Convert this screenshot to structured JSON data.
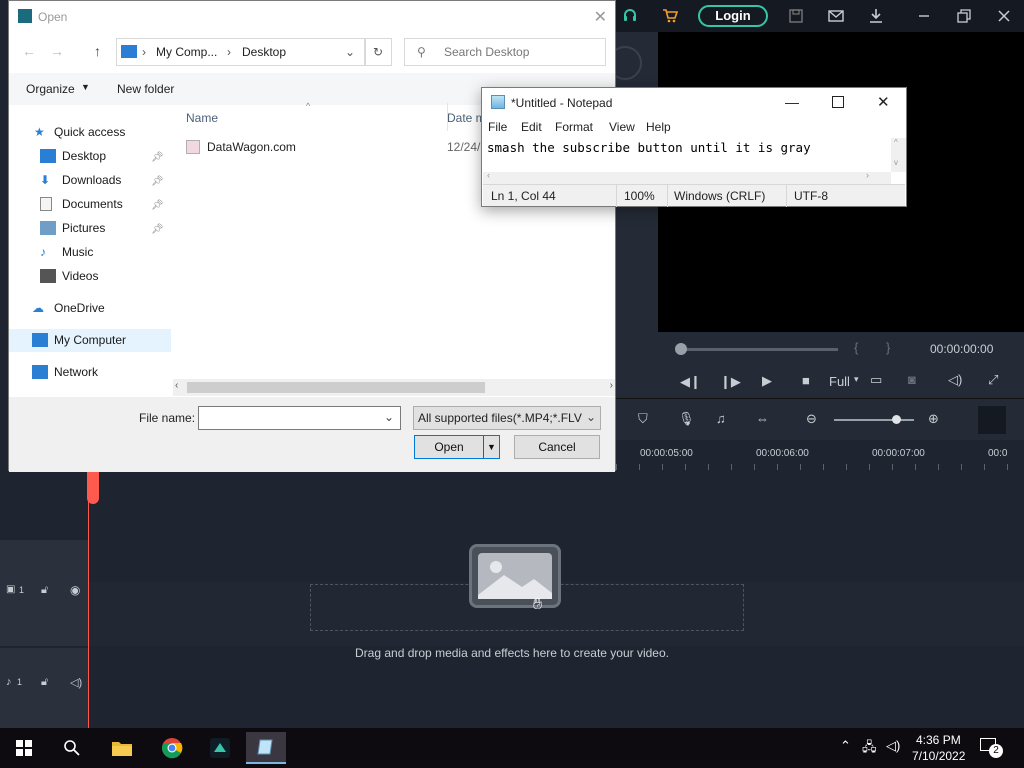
{
  "filmora": {
    "login_label": "Login",
    "zoom_mode": "Full",
    "timecode": "00:00:00:00",
    "ruler_ticks": [
      "00:00:05:00",
      "00:00:06:00",
      "00:00:07:00",
      "00:0"
    ],
    "drop_hint": "Drag and drop media and effects here to create your video.",
    "video_track_label": "1",
    "audio_track_label": "1",
    "bracket_in": "{",
    "bracket_out": "}",
    "accent_color": "#36c6a7",
    "playhead_color": "#ff5a4e"
  },
  "open_dialog": {
    "title": "Open",
    "address": {
      "segments": [
        "My Comp...",
        "Desktop"
      ]
    },
    "search_placeholder": "Search Desktop",
    "organize_label": "Organize",
    "new_folder_label": "New folder",
    "columns": {
      "name": "Name",
      "date": "Date m"
    },
    "nav_items": {
      "quick_access": "Quick access",
      "desktop": "Desktop",
      "downloads": "Downloads",
      "documents": "Documents",
      "pictures": "Pictures",
      "music": "Music",
      "videos": "Videos",
      "onedrive": "OneDrive",
      "my_computer": "My Computer",
      "network": "Network"
    },
    "files": [
      {
        "name": "DataWagon.com",
        "date": "12/24/"
      }
    ],
    "filename_label": "File name:",
    "filename_value": "",
    "filetype_value": "All supported files(*.MP4;*.FLV;",
    "open_label": "Open",
    "cancel_label": "Cancel"
  },
  "notepad": {
    "title": "*Untitled - Notepad",
    "menu": {
      "file": "File",
      "edit": "Edit",
      "format": "Format",
      "view": "View",
      "help": "Help"
    },
    "content": "smash the subscribe button until it is gray",
    "status": {
      "position": "Ln 1, Col 44",
      "zoom": "100%",
      "line_ending": "Windows (CRLF)",
      "encoding": "UTF-8"
    }
  },
  "taskbar": {
    "time": "4:36 PM",
    "date": "7/10/2022",
    "notification_count": "2"
  }
}
